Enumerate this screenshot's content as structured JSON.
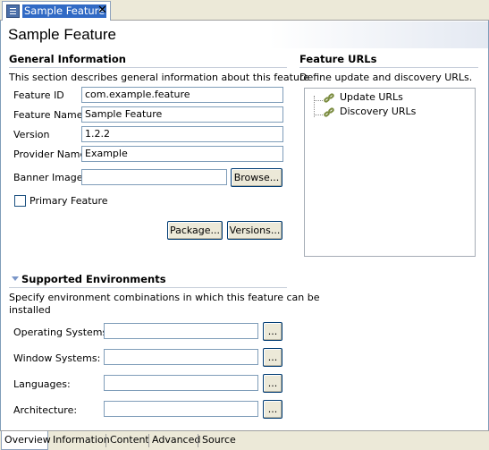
{
  "editor_tab": {
    "title": "Sample Feature",
    "icon": "feature-icon",
    "close": "✕"
  },
  "page_title": "Sample Feature",
  "general": {
    "title": "General Information",
    "description": "This section describes general information about this feature",
    "fields": [
      {
        "label": "Feature ID",
        "value": "com.example.feature"
      },
      {
        "label": "Feature Name",
        "value": "Sample Feature"
      },
      {
        "label": "Version",
        "value": "1.2.2"
      },
      {
        "label": "Provider Name",
        "value": "Example"
      },
      {
        "label": "Banner Image",
        "value": ""
      }
    ],
    "browse_label": "Browse...",
    "primary_feature_label": "Primary Feature",
    "primary_feature_checked": false,
    "package_label": "Package...",
    "versions_label": "Versions..."
  },
  "environments": {
    "title": "Supported Environments",
    "description_line1": "Specify environment combinations in which this feature can be",
    "description_line2": "installed",
    "fields": [
      {
        "label": "Operating Systems:",
        "value": "",
        "button": "..."
      },
      {
        "label": "Window Systems:",
        "value": "",
        "button": "..."
      },
      {
        "label": "Languages:",
        "value": "",
        "button": "..."
      },
      {
        "label": "Architecture:",
        "value": "",
        "button": "..."
      }
    ]
  },
  "urls": {
    "title": "Feature URLs",
    "description": "Define update and discovery URLs.",
    "items": [
      {
        "label": "Update URLs",
        "icon": "url-icon"
      },
      {
        "label": "Discovery URLs",
        "icon": "url-icon"
      }
    ]
  },
  "bottom_tabs": [
    "Overview",
    "Information",
    "Content",
    "Advanced",
    "Source"
  ],
  "colors": {
    "tab_highlight": "#316ac5",
    "section_line": "#c5cdd9",
    "chrome": "#ece9d8"
  }
}
